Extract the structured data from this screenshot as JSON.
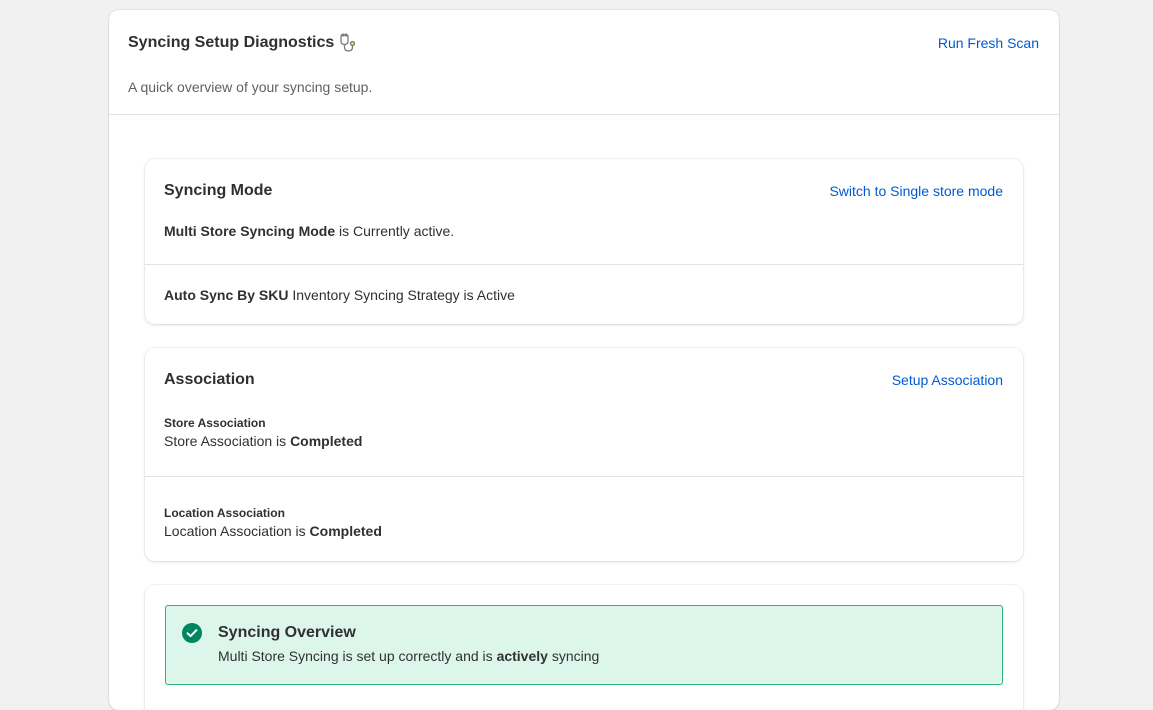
{
  "header": {
    "title": "Syncing Setup Diagnostics",
    "subtitle": "A quick overview of your syncing setup.",
    "action_label": "Run Fresh Scan",
    "title_icon": "stethoscope-icon"
  },
  "syncing_mode": {
    "title": "Syncing Mode",
    "action_label": "Switch to Single store mode",
    "mode_name": "Multi Store Syncing Mode",
    "mode_suffix": " is Currently active.",
    "strategy_name": "Auto Sync By SKU",
    "strategy_suffix": " Inventory Syncing Strategy is Active"
  },
  "association": {
    "title": "Association",
    "action_label": "Setup Association",
    "items": [
      {
        "heading": "Store Association",
        "prefix": "Store Association is ",
        "status": "Completed"
      },
      {
        "heading": "Location Association",
        "prefix": "Location Association is ",
        "status": "Completed"
      }
    ]
  },
  "overview": {
    "title": "Syncing Overview",
    "text_prefix": "Multi Store Syncing is set up correctly and is ",
    "text_emphasis": "actively",
    "text_suffix": " syncing",
    "icon": "check-circle-icon"
  },
  "colors": {
    "link": "#005bd3",
    "success_bg": "#dcf6ec",
    "success_border": "#2fb57b",
    "success_icon": "#00865f"
  }
}
